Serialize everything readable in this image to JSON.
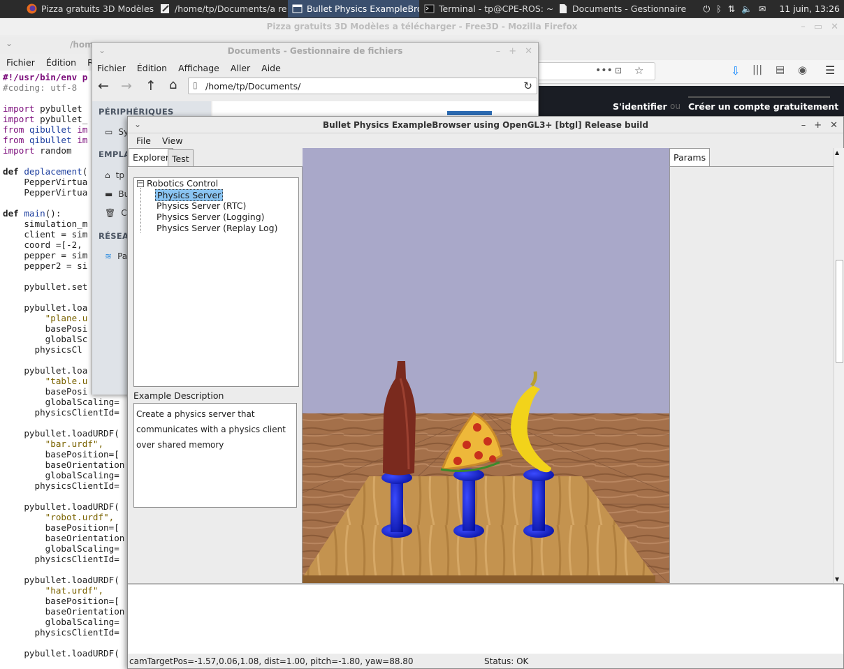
{
  "taskbar": {
    "tasks": [
      {
        "label": "Pizza gratuits 3D Modèles ..."
      },
      {
        "label": "/home/tp/Documents/a re..."
      },
      {
        "label": "Bullet Physics ExampleBro..."
      },
      {
        "label": "Terminal - tp@CPE-ROS: ~/..."
      },
      {
        "label": "Documents - Gestionnaire ..."
      }
    ],
    "clock": "11 juin, 13:26"
  },
  "firefox": {
    "title": "Pizza gratuits 3D Modèles a télécharger - Free3D - Mozilla Firefox",
    "signin": "S'identifier",
    "or": "ou",
    "create_account": "Créer un compte gratuitement"
  },
  "editor": {
    "title": "/home",
    "menu": [
      "Fichier",
      "Édition",
      "Re"
    ],
    "lines": [
      "#!/usr/bin/env p",
      "#coding: utf-8",
      "",
      "import pybullet",
      "import pybullet_",
      "from qibullet im",
      "from qibullet im",
      "import random",
      "",
      "def deplacement(",
      "    PepperVirtua",
      "    PepperVirtua",
      "",
      "def main():",
      "    simulation_m",
      "    client = sim",
      "    coord =[-2, ",
      "    pepper = sim",
      "    pepper2 = si",
      "",
      "    pybullet.set",
      "",
      "    pybullet.loa",
      "        \"plane.u",
      "        basePosi",
      "        globalSc",
      "      physicsCl",
      "",
      "    pybullet.loa",
      "        \"table.u",
      "        basePosi",
      "        globalScaling=",
      "      physicsClientId=",
      "",
      "    pybullet.loadURDF(",
      "        \"bar.urdf\",",
      "        basePosition=[",
      "        baseOrientation",
      "        globalScaling=",
      "      physicsClientId=",
      "",
      "    pybullet.loadURDF(",
      "        \"robot.urdf\",",
      "        basePosition=[",
      "        baseOrientation",
      "        globalScaling=",
      "      physicsClientId=",
      "",
      "    pybullet.loadURDF(",
      "        \"hat.urdf\",",
      "        basePosition=[",
      "        baseOrientation",
      "        globalScaling=",
      "      physicsClientId=",
      "",
      "    pybullet.loadURDF("
    ]
  },
  "filemanager": {
    "title": "Documents - Gestionnaire de fichiers",
    "menu": [
      "Fichier",
      "Édition",
      "Affichage",
      "Aller",
      "Aide"
    ],
    "path": "/home/tp/Documents/",
    "sections": {
      "devices": "PÉRIPHÉRIQUES",
      "places": "EMPLA",
      "network": "RÉSEAU"
    },
    "items": {
      "system": "Sy",
      "home": "tp",
      "desktop": "Bu",
      "trash": "Co",
      "network": "Pa"
    }
  },
  "bullet": {
    "title": "Bullet Physics ExampleBrowser using OpenGL3+ [btgl] Release build",
    "menu": [
      "File",
      "View"
    ],
    "tabs": [
      "Explorer",
      "Test"
    ],
    "params_tab": "Params",
    "tree_root": "Robotics Control",
    "tree_items": [
      "Physics Server",
      "Physics Server (RTC)",
      "Physics Server (Logging)",
      "Physics Server (Replay Log)"
    ],
    "desc_label": "Example Description",
    "desc_lines": [
      "Create a physics server that",
      "communicates with a physics client",
      "over shared memory"
    ],
    "status_cam": "camTargetPos=-1.57,0.06,1.08, dist=1.00, pitch=-1.80, yaw=88.80",
    "status": "Status: OK"
  },
  "colors": {
    "sky": "#a9a8c9",
    "stand_blue": "#0c1ed6",
    "bottle": "#7a2a1e",
    "banana": "#f2d31a",
    "taskbar_active": "#3a4f6e"
  }
}
